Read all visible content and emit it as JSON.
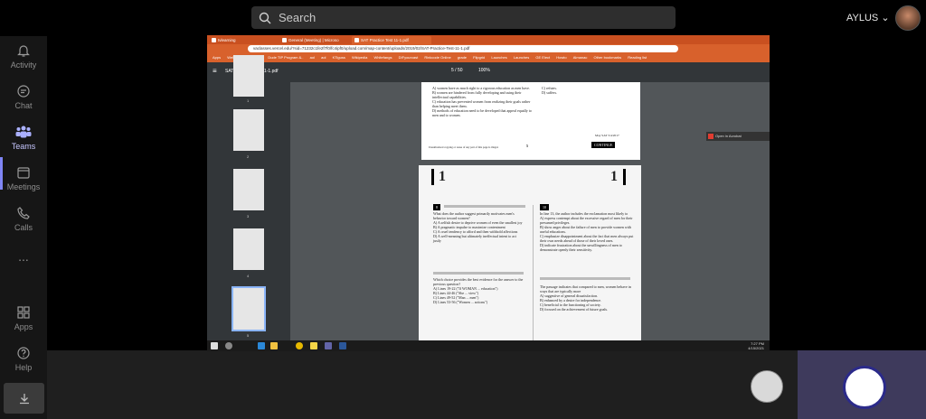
{
  "search": {
    "placeholder": "Search"
  },
  "user": {
    "name": "AYLUS"
  },
  "rail": [
    {
      "label": "Activity",
      "icon": "bell-icon"
    },
    {
      "label": "Chat",
      "icon": "chat-icon"
    },
    {
      "label": "Teams",
      "icon": "teams-icon"
    },
    {
      "label": "Meetings",
      "icon": "calendar-icon"
    },
    {
      "label": "Calls",
      "icon": "phone-icon"
    },
    {
      "label": "...",
      "icon": "more-icon"
    },
    {
      "label": "Apps",
      "icon": "apps-icon"
    },
    {
      "label": "Help",
      "icon": "help-icon"
    }
  ],
  "browser": {
    "tabs": [
      "tvlearning",
      "General (Meeting) | Microso",
      "SAT Practice Test 11-1.pdf"
    ],
    "url": "vaclasses.vercel.edu/?sid=71232c1fe2f7f0/fc4ipf0/upload.com/map-content/uploads/2019/02/SAT-Practice-Test-11-1.pdf",
    "bookmarks": [
      "Apps",
      "Welcome Family Ho..",
      "Dude TIP Program &..",
      "aol",
      "aol",
      "KTiguss",
      "Wikipedia",
      "Whitefangs",
      "DIFyourcast",
      "Rinkcode Online",
      "grade",
      "Flipgrid",
      "Launches",
      "Launches",
      "GE Elect",
      "Howto",
      "Almanac",
      "Other bookmarks",
      "Reading list"
    ]
  },
  "pdf": {
    "title": "SAT Practice Test 11-1.pdf",
    "page": "5",
    "pages": "/ 50",
    "zoom": "100%",
    "thumb_numbers": [
      "1",
      "2",
      "3",
      "4",
      "5"
    ],
    "page_a": {
      "lines": [
        "A)  women have as much right to a rigorous education as men have.",
        "B)  women are hindered from fully developing and using their intellectual capabilities.",
        "C)  education has prevented women from realizing their goals rather than helping meet them.",
        "D)  methods of education need to be developed that appeal equally to men and to women."
      ],
      "right": [
        "C)  refutes.",
        "D)  suffers."
      ],
      "footer": "Unauthorized copying or reuse of any part of this page is illegal.",
      "date": "May SAT 5/4/2017",
      "continue": "CONTINUE",
      "page_num": "5"
    },
    "page_b": {
      "section": "1",
      "q1": "What does the author suggest primarily motivates men's behavior toward women?",
      "q1_opts": [
        "A)  A selfish desire to deprive women of even the smallest joy",
        "B)  A pragmatic impulse to maximize contentment",
        "C)  A cruel tendency to afford and then withhold affections",
        "D)  A well-meaning but ultimately ineffectual intent to act justly"
      ],
      "q2": "Which choice provides the best evidence for the answer to the previous question?",
      "q2_opts": [
        "A)  Lines 19-22 (\"If WOMAN ... education\")",
        "B)  Lines 44-46 (\"She ... view\")",
        "C)  Lines 49-52 (\"Man ... men\")",
        "D)  Lines 53-56 (\"Women ... actions\")"
      ],
      "q3": "In line 13, the author includes the exclamation most likely to",
      "q3_opts": [
        "A)  express contempt about the excessive regard of men for their presumed privileges.",
        "B)  show anger about the failure of men to provide women with useful educations.",
        "C)  emphasize disappointment about the fact that men always put their own needs ahead of those of their loved ones.",
        "D)  indicate frustration about the unwillingness of men to demonstrate openly their sensitivity."
      ],
      "q4": "The passage indicates that compared to men, women behave in ways that are typically more",
      "q4_opts": [
        "A)  suggestive of general dissatisfaction.",
        "B)  enhanced by a desire for independence.",
        "C)  beneficial to the functioning of society.",
        "D)  focused on the achievement of future goals."
      ],
      "qnum_left": "8",
      "qnum_right": "10"
    },
    "acrobat": "Open in Acrobat"
  },
  "taskbar": {
    "time": "7:27 PM",
    "date": "4/15/2021"
  }
}
